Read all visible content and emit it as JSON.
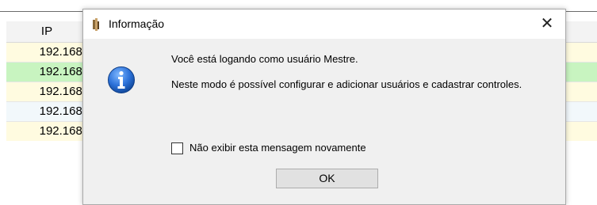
{
  "table": {
    "column_header": "IP",
    "rows": [
      {
        "ip": "192.168."
      },
      {
        "ip": "192.168."
      },
      {
        "ip": "192.168."
      },
      {
        "ip": "192.168."
      },
      {
        "ip": "192.168."
      }
    ]
  },
  "dialog": {
    "title": "Informação",
    "close_glyph": "✕",
    "icon": "info-icon",
    "message_line1": "Você está logando como usuário Mestre.",
    "message_line2": "Neste modo é possível configurar e adicionar usuários e cadastrar controles.",
    "checkbox_label": "Não exibir esta mensagem novamente",
    "checkbox_checked": false,
    "ok_label": "OK"
  }
}
